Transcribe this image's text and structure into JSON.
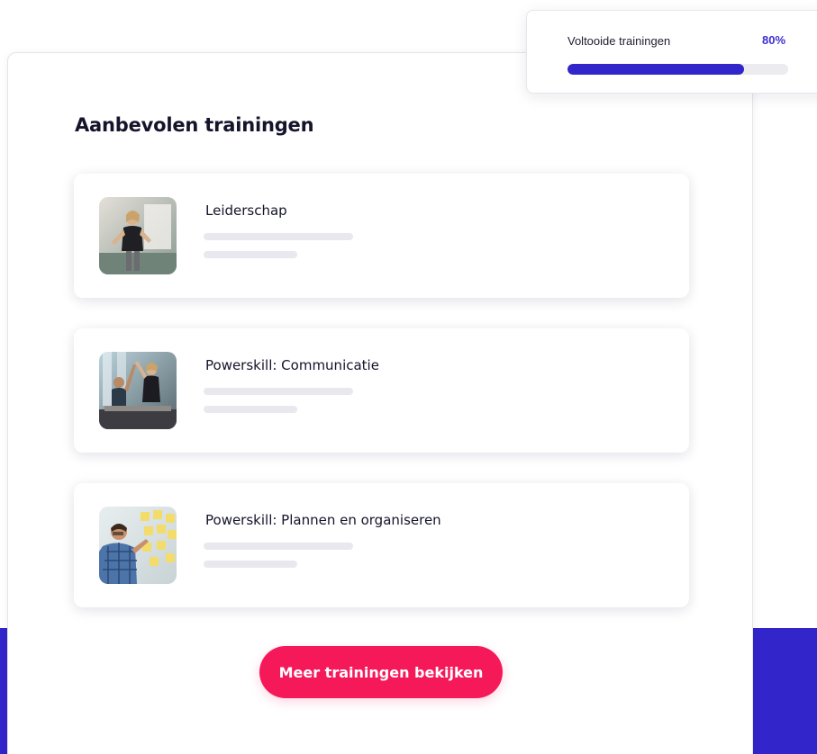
{
  "progress": {
    "label": "Voltooide trainingen",
    "value_text": "80%",
    "fraction": 0.8
  },
  "section": {
    "title": "Aanbevolen trainingen"
  },
  "trainings": [
    {
      "title": "Leiderschap"
    },
    {
      "title": "Powerskill: Communicatie"
    },
    {
      "title": "Powerskill: Plannen en organiseren"
    }
  ],
  "cta": {
    "label": "Meer trainingen bekijken"
  },
  "colors": {
    "accent_purple": "#3225c9",
    "cta_pink": "#f5195a",
    "text_dark": "#14142b"
  }
}
